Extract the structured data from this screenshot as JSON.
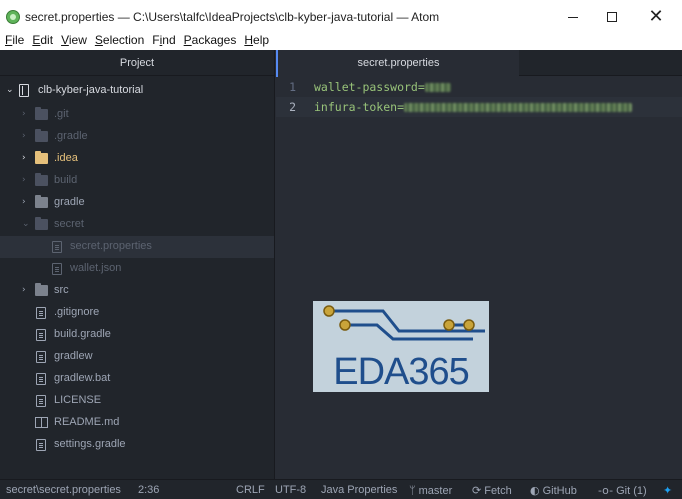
{
  "window": {
    "title": "secret.properties — C:\\Users\\talfc\\IdeaProjects\\clb-kyber-java-tutorial — Atom",
    "minimize_glyph": "",
    "close_glyph": "✕"
  },
  "menu": [
    {
      "key": "F",
      "rest": "ile"
    },
    {
      "key": "E",
      "rest": "dit"
    },
    {
      "key": "V",
      "rest": "iew"
    },
    {
      "key": "S",
      "rest": "election"
    },
    {
      "key": "",
      "pre": "F",
      "key2": "i",
      "rest": "nd"
    },
    {
      "key": "P",
      "rest": "ackages"
    },
    {
      "key": "H",
      "rest": "elp"
    }
  ],
  "menu_labels": [
    "File",
    "Edit",
    "View",
    "Selection",
    "Find",
    "Packages",
    "Help"
  ],
  "tree": {
    "header": "Project",
    "root": "clb-kyber-java-tutorial",
    "items": [
      {
        "label": ".git",
        "type": "folder",
        "state": "collapsed"
      },
      {
        "label": ".gradle",
        "type": "folder",
        "state": "collapsed"
      },
      {
        "label": ".idea",
        "type": "folder",
        "state": "collapsed"
      },
      {
        "label": "build",
        "type": "folder",
        "state": "collapsed"
      },
      {
        "label": "gradle",
        "type": "folder",
        "state": "collapsed"
      },
      {
        "label": "secret",
        "type": "folder",
        "state": "expanded"
      },
      {
        "label": "secret.properties",
        "type": "file",
        "state": "selected"
      },
      {
        "label": "wallet.json",
        "type": "file"
      },
      {
        "label": "src",
        "type": "folder",
        "state": "collapsed"
      },
      {
        "label": ".gitignore",
        "type": "file"
      },
      {
        "label": "build.gradle",
        "type": "file"
      },
      {
        "label": "gradlew",
        "type": "file"
      },
      {
        "label": "gradlew.bat",
        "type": "file"
      },
      {
        "label": "LICENSE",
        "type": "file"
      },
      {
        "label": "README.md",
        "type": "file"
      },
      {
        "label": "settings.gradle",
        "type": "file"
      }
    ]
  },
  "editor": {
    "tab": "secret.properties",
    "lines": [
      {
        "num": "1",
        "text": "wallet-password="
      },
      {
        "num": "2",
        "text": "infura-token="
      }
    ]
  },
  "watermark": {
    "text": "EDA365"
  },
  "status": {
    "path": "secret\\secret.properties",
    "cursor": "2:36",
    "line_ending": "CRLF",
    "encoding": "UTF-8",
    "grammar": "Java Properties",
    "branch": "master",
    "fetch": "Fetch",
    "github": "GitHub",
    "git": "Git (1)"
  },
  "colors": {
    "accent": "#568af2",
    "string": "#98c379",
    "folder_yellow": "#e5c07b",
    "tree_bg": "#21252b",
    "editor_bg": "#282c34"
  }
}
